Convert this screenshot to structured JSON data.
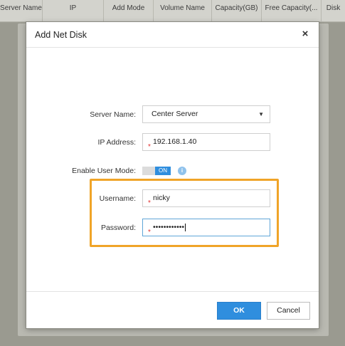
{
  "background_table": {
    "columns": [
      "Server Name",
      "IP",
      "Add Mode",
      "Volume Name",
      "Capacity(GB)",
      "Free Capacity(...",
      "Disk"
    ]
  },
  "dialog": {
    "title": "Add Net Disk",
    "close_glyph": "×",
    "fields": {
      "server_name": {
        "label": "Server Name:",
        "value": "Center Server",
        "caret": "▼"
      },
      "ip_address": {
        "label": "IP Address:",
        "value": "192.168.1.40",
        "required_mark": "*"
      },
      "user_mode": {
        "label": "Enable User Mode:",
        "toggle_text": "ON",
        "info_glyph": "i"
      },
      "username": {
        "label": "Username:",
        "value": "nicky",
        "required_mark": "*"
      },
      "password": {
        "label": "Password:",
        "value": "••••••••••••",
        "required_mark": "*"
      }
    },
    "buttons": {
      "ok": "OK",
      "cancel": "Cancel"
    }
  },
  "colors": {
    "accent": "#2f8ede",
    "highlight": "#f0a428",
    "required": "#e23333"
  }
}
